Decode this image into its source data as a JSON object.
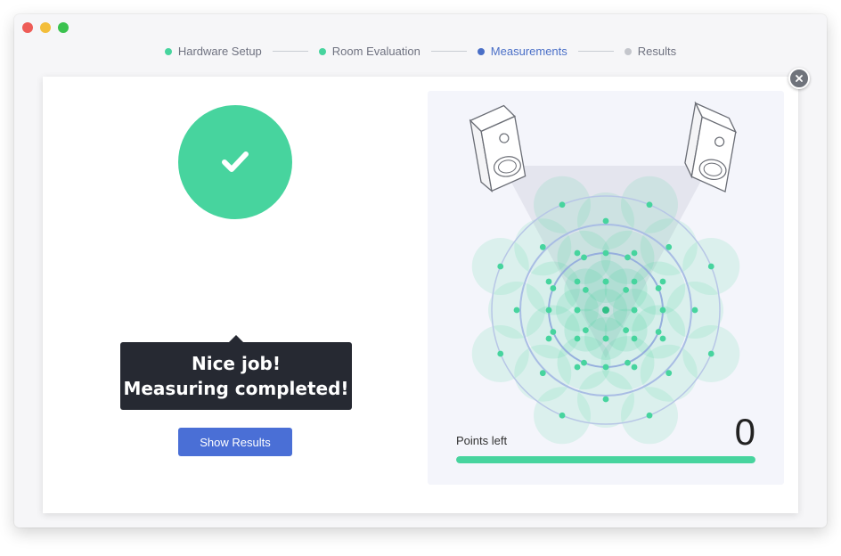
{
  "steps": [
    {
      "label": "Hardware Setup",
      "state": "done"
    },
    {
      "label": "Room Evaluation",
      "state": "done"
    },
    {
      "label": "Measurements",
      "state": "active"
    },
    {
      "label": "Results",
      "state": "pending"
    }
  ],
  "colors": {
    "done": "#47d49e",
    "active": "#4a6fc7",
    "pending": "#c4c6cc",
    "accent_button": "#4a6fd6",
    "tooltip_bg": "#262932"
  },
  "status": {
    "icon": "check-icon",
    "message_line1": "Nice job!",
    "message_line2": "Measuring completed!"
  },
  "actions": {
    "show_results_label": "Show Results",
    "close_icon": "close-icon"
  },
  "progress": {
    "label": "Points left",
    "points_left": "0",
    "fill_fraction": 1.0
  }
}
